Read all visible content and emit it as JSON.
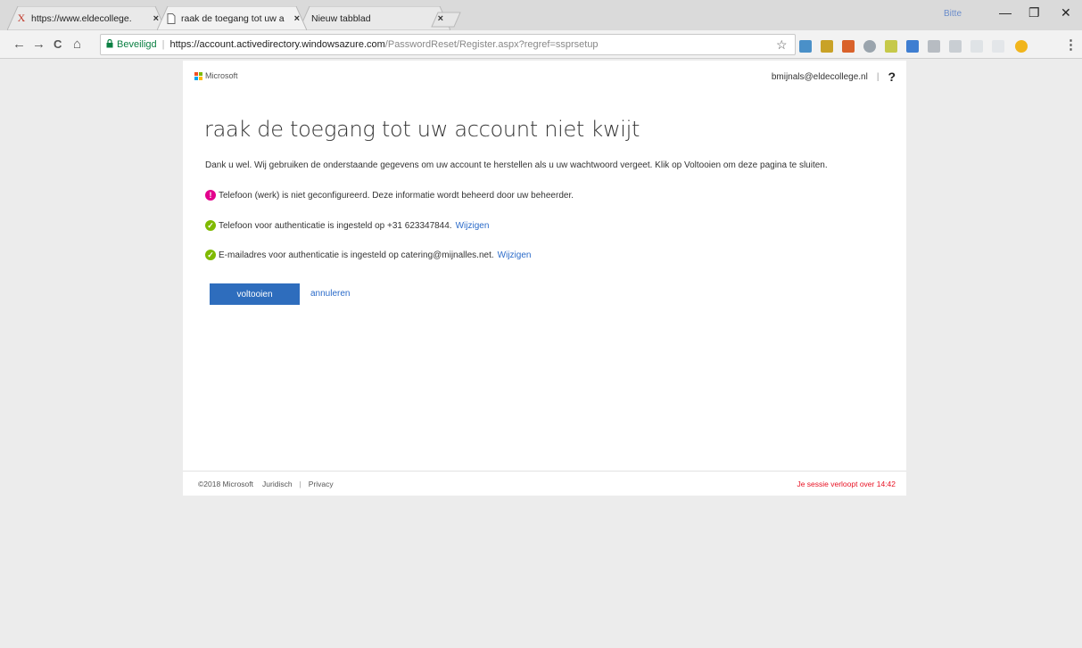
{
  "browser": {
    "tabs": [
      {
        "title": "https://www.eldecollege.",
        "favicon": "x-favicon",
        "close": "×"
      },
      {
        "title": "raak de toegang tot uw a",
        "favicon": "page-favicon",
        "close": "×"
      },
      {
        "title": "Nieuw tabblad",
        "favicon": "",
        "close": "×"
      }
    ],
    "profile_label": "Bitte",
    "window_controls": {
      "minimize": "—",
      "restore": "❐",
      "close": "✕"
    },
    "nav": {
      "back": "←",
      "forward": "→",
      "reload": "C",
      "home": "⌂"
    },
    "address": {
      "secure_label": "Beveiligd",
      "separator": "|",
      "host": "https://account.activedirectory.windowsazure.com",
      "path": "/PasswordReset/Register.aspx?regref=ssprsetup"
    },
    "star": "☆",
    "menu": "⋮"
  },
  "header": {
    "brand": "Microsoft",
    "user_email": "bmijnals@eldecollege.nl",
    "separator": "|",
    "help": "?"
  },
  "main": {
    "title": "raak de toegang tot uw account niet kwijt",
    "intro": "Dank u wel. Wij gebruiken de onderstaande gegevens om uw account te herstellen als u uw wachtwoord vergeet. Klik op Voltooien om deze pagina te sluiten.",
    "items": [
      {
        "status": "warning",
        "icon": "!",
        "text": "Telefoon (werk) is niet geconfigureerd. Deze informatie wordt beheerd door uw beheerder.",
        "link": ""
      },
      {
        "status": "ok",
        "icon": "✓",
        "text": "Telefoon voor authenticatie is ingesteld op +31 623347844.",
        "link": "Wijzigen"
      },
      {
        "status": "ok",
        "icon": "✓",
        "text": "E-mailadres voor authenticatie is ingesteld op catering@mijnalles.net.",
        "link": "Wijzigen"
      }
    ],
    "primary_button": "voltooien",
    "cancel_link": "annuleren"
  },
  "footer": {
    "copyright": "©2018 Microsoft",
    "legal": "Juridisch",
    "separator": "|",
    "privacy": "Privacy",
    "session": "Je sessie verloopt over 14:42"
  },
  "colors": {
    "accent": "#2e6dbd",
    "warning": "#e3008c",
    "success": "#7fba00",
    "session_text": "#e81123"
  }
}
